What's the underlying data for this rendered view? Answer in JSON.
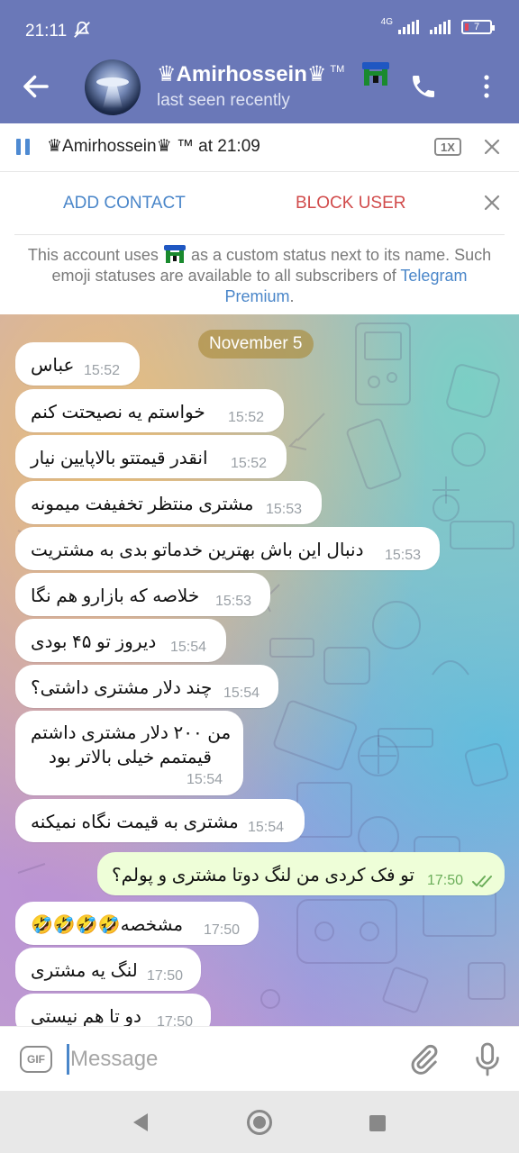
{
  "status_bar": {
    "time": "21:11",
    "network": "4G",
    "battery": "7"
  },
  "header": {
    "title": "♛Amirhossein♛",
    "tm": "TM",
    "subtitle": "last seen recently",
    "colors": {
      "header_bg": "#6a78b8"
    }
  },
  "audio_player": {
    "title": "♛Amirhossein♛ ™ at 21:09",
    "speed": "1X"
  },
  "actions": {
    "add_contact": "ADD CONTACT",
    "block_user": "BLOCK USER",
    "note_before_emoji": "This account uses",
    "note_after_emoji": "as a custom status next to its name. Such emoji statuses are available to all subscribers of",
    "note_link": "Telegram Premium",
    "note_end": "."
  },
  "chat": {
    "date": "November 5",
    "messages": [
      {
        "text": "عباس",
        "time": "15:52",
        "direction": "in"
      },
      {
        "text": "خواستم یه نصیحتت کنم",
        "time": "15:52",
        "direction": "in"
      },
      {
        "text": "انقدر قیمتتو بالاپایین نیار",
        "time": "15:52",
        "direction": "in"
      },
      {
        "text": "مشتری منتظر تخفیفت میمونه",
        "time": "15:53",
        "direction": "in"
      },
      {
        "text": "دنبال این باش بهترین خدماتو بدی به مشتریت",
        "time": "15:53",
        "direction": "in"
      },
      {
        "text": "خلاصه که بازارو هم نگا",
        "time": "15:53",
        "direction": "in"
      },
      {
        "text": "دیروز تو ۴۵ بودی",
        "time": "15:54",
        "direction": "in"
      },
      {
        "text": "چند دلار مشتری داشتی؟",
        "time": "15:54",
        "direction": "in"
      },
      {
        "text_line1": "من ۲۰۰ دلار مشتری داشتم",
        "text_line2": "قیمتمم خیلی بالاتر بود",
        "time": "15:54",
        "direction": "in"
      },
      {
        "text": "مشتری به قیمت نگاه نمیکنه",
        "time": "15:54",
        "direction": "in"
      },
      {
        "text": "تو فک کردی من لنگ دوتا مشتری و پولم؟",
        "time": "17:50",
        "direction": "out",
        "status": "read"
      },
      {
        "text": "مشخصه🤣🤣🤣🤣",
        "time": "17:50",
        "direction": "in"
      },
      {
        "text": "لنگ یه مشتری",
        "time": "17:50",
        "direction": "in"
      },
      {
        "text": "دو تا هم نیستی",
        "time": "17:50",
        "direction": "in"
      }
    ]
  },
  "input": {
    "gif_label": "GIF",
    "placeholder": "Message"
  }
}
